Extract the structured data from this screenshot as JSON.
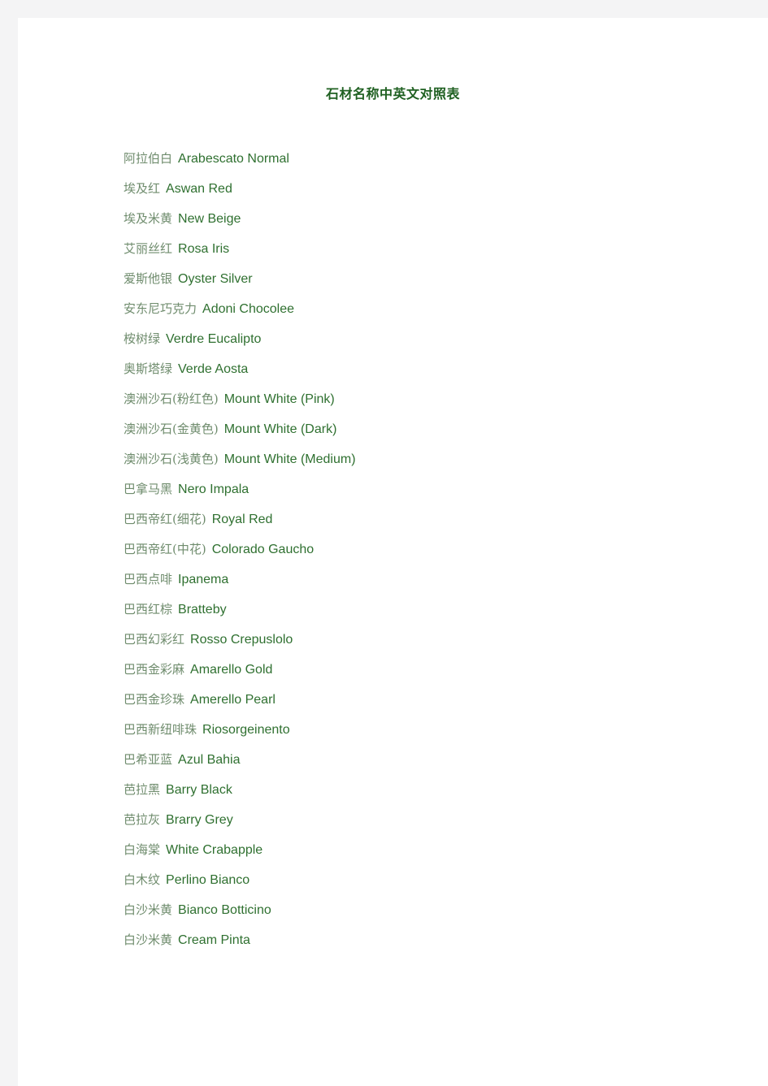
{
  "document": {
    "title": "石材名称中英文对照表",
    "colors": {
      "page_background": "#ffffff",
      "canvas_background": "#f4f4f5",
      "title_color": "#1f6021",
      "chinese_text_color": "#6f8c6d",
      "english_text_color": "#2f7030"
    },
    "entries": [
      {
        "cn": "阿拉伯白",
        "en": "Arabescato Normal"
      },
      {
        "cn": "埃及红",
        "en": "Aswan Red"
      },
      {
        "cn": "埃及米黄",
        "en": "New Beige"
      },
      {
        "cn": "艾丽丝红",
        "en": "Rosa Iris"
      },
      {
        "cn": "爱斯他银",
        "en": "Oyster Silver"
      },
      {
        "cn": "安东尼巧克力",
        "en": "Adoni Chocolee"
      },
      {
        "cn": "桉树绿",
        "en": "Verdre Eucalipto"
      },
      {
        "cn": "奥斯塔绿",
        "en": "Verde Aosta"
      },
      {
        "cn": "澳洲沙石(粉红色)",
        "en": "Mount White (Pink)"
      },
      {
        "cn": "澳洲沙石(金黄色)",
        "en": "Mount White (Dark)"
      },
      {
        "cn": "澳洲沙石(浅黄色)",
        "en": "Mount White (Medium)"
      },
      {
        "cn": "巴拿马黑",
        "en": "Nero Impala"
      },
      {
        "cn": "巴西帝红(细花)",
        "en": "Royal Red"
      },
      {
        "cn": "巴西帝红(中花)",
        "en": "Colorado Gaucho"
      },
      {
        "cn": "巴西点啡",
        "en": "Ipanema"
      },
      {
        "cn": "巴西红棕",
        "en": "Bratteby"
      },
      {
        "cn": "巴西幻彩红",
        "en": "Rosso Crepuslolo"
      },
      {
        "cn": "巴西金彩麻",
        "en": "Amarello Gold"
      },
      {
        "cn": "巴西金珍珠",
        "en": "Amerello Pearl"
      },
      {
        "cn": "巴西新纽啡珠",
        "en": "Riosorgeinento"
      },
      {
        "cn": "巴希亚蓝",
        "en": "Azul Bahia"
      },
      {
        "cn": "芭拉黑",
        "en": "Barry Black"
      },
      {
        "cn": "芭拉灰",
        "en": "Brarry Grey"
      },
      {
        "cn": "白海棠",
        "en": "White Crabapple"
      },
      {
        "cn": "白木纹",
        "en": "Perlino Bianco"
      },
      {
        "cn": "白沙米黄",
        "en": "Bianco Botticino"
      },
      {
        "cn": "白沙米黄",
        "en": "Cream Pinta"
      }
    ]
  }
}
